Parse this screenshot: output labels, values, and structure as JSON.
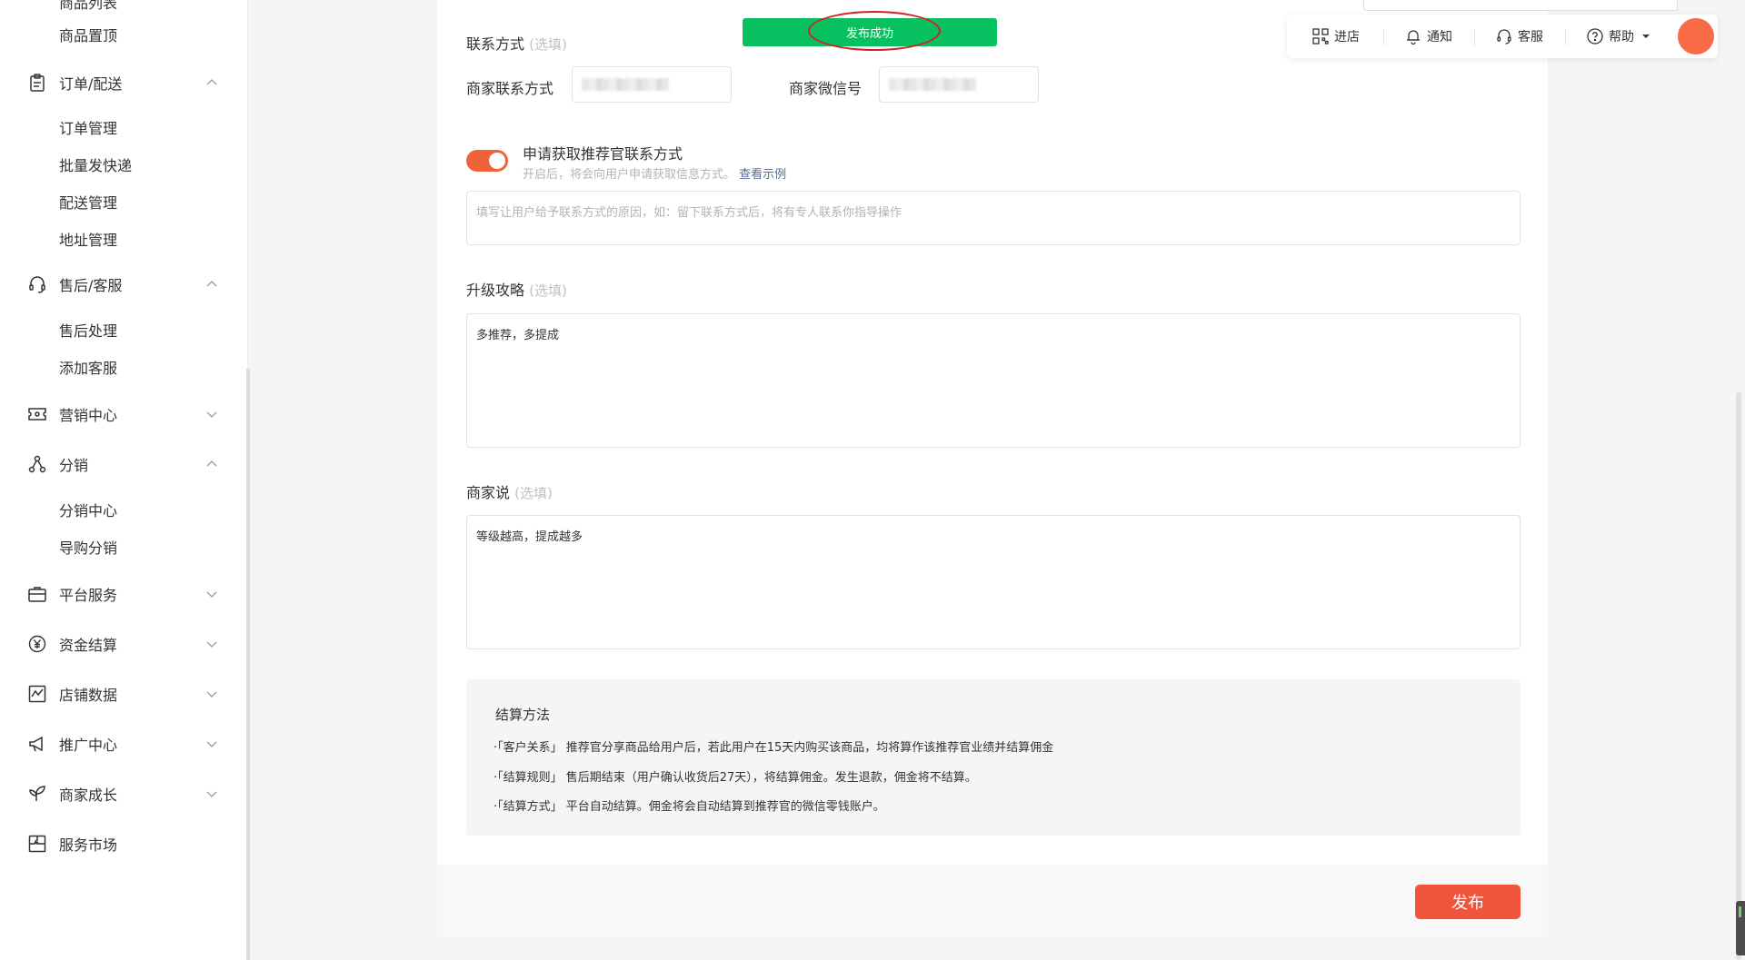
{
  "sidebar": {
    "top_items": [
      "商品列表",
      "商品置顶"
    ],
    "groups": [
      {
        "label": "订单/配送",
        "icon": "clipboard-icon",
        "expanded": true,
        "subs": [
          "订单管理",
          "批量发快递",
          "配送管理",
          "地址管理"
        ]
      },
      {
        "label": "售后/客服",
        "icon": "headset-icon",
        "expanded": true,
        "subs": [
          "售后处理",
          "添加客服"
        ]
      },
      {
        "label": "营销中心",
        "icon": "ticket-icon",
        "expanded": false,
        "subs": []
      },
      {
        "label": "分销",
        "icon": "network-icon",
        "expanded": true,
        "subs": [
          "分销中心",
          "导购分销"
        ]
      },
      {
        "label": "平台服务",
        "icon": "briefcase-icon",
        "expanded": false,
        "subs": []
      },
      {
        "label": "资金结算",
        "icon": "yen-icon",
        "expanded": false,
        "subs": []
      },
      {
        "label": "店铺数据",
        "icon": "chart-icon",
        "expanded": false,
        "subs": []
      },
      {
        "label": "推广中心",
        "icon": "megaphone-icon",
        "expanded": false,
        "subs": []
      },
      {
        "label": "商家成长",
        "icon": "sprout-icon",
        "expanded": false,
        "subs": []
      },
      {
        "label": "服务市场",
        "icon": "puzzle-icon",
        "expanded": null,
        "subs": []
      }
    ]
  },
  "toast": {
    "text": "发布成功",
    "color": "#07c160"
  },
  "topbar": {
    "items": [
      "进店",
      "通知",
      "客服",
      "帮助"
    ]
  },
  "form": {
    "contact": {
      "label": "联系方式",
      "optional": "(选填)",
      "merchant_contact_label": "商家联系方式",
      "merchant_wechat_label": "商家微信号"
    },
    "apply": {
      "label": "申请获取推荐官联系方式",
      "enabled": true,
      "hint": "开启后，将会向用户申请获取信息方式。",
      "example_link": "查看示例",
      "reason_placeholder": "填写让用户给予联系方式的原因，如：留下联系方式后，将有专人联系你指导操作"
    },
    "upgrade": {
      "label": "升级攻略",
      "optional": "(选填)",
      "value": "多推荐，多提成"
    },
    "merchant_says": {
      "label": "商家说",
      "optional": "(选填)",
      "value": "等级越高，提成越多"
    },
    "settlement": {
      "title": "结算方法",
      "lines": [
        "·「客户关系」 推荐官分享商品给用户后，若此用户在15天内购买该商品，均将算作该推荐官业绩并结算佣金",
        "·「结算规则」 售后期结束（用户确认收货后27天），将结算佣金。发生退款，佣金将不结算。",
        "·「结算方式」 平台自动结算。佣金将会自动结算到推荐官的微信零钱账户。"
      ]
    },
    "publish_label": "发布",
    "accent_color": "#f0553c"
  }
}
